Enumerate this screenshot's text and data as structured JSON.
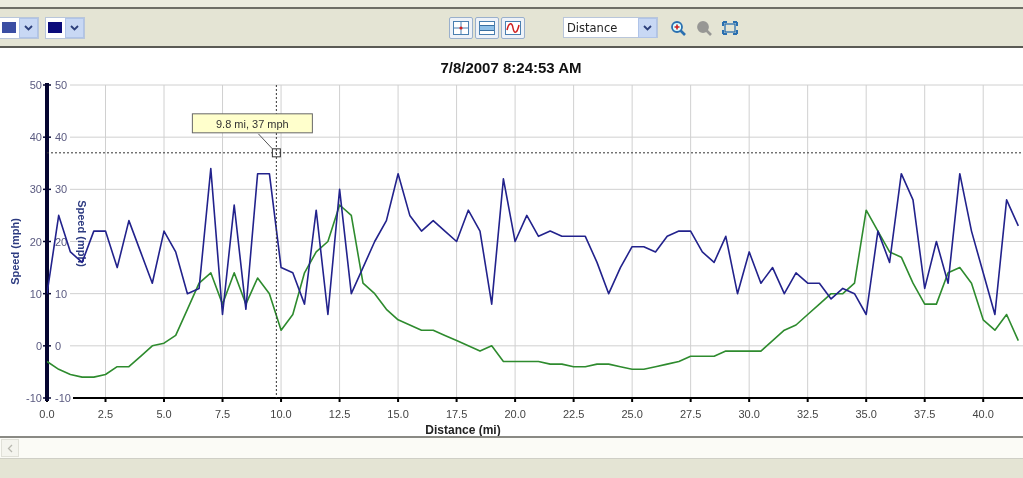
{
  "toolbar": {
    "color_pickers": [
      {
        "color": "#3b4ea3"
      },
      {
        "color": "#0b0b7a"
      }
    ],
    "view_buttons": [
      {
        "kind": "crosshair"
      },
      {
        "kind": "band"
      },
      {
        "kind": "wave"
      }
    ],
    "axis_select": {
      "value": "Distance"
    },
    "zoom_buttons": [
      {
        "kind": "zoom_in",
        "disabled": false
      },
      {
        "kind": "zoom_out",
        "disabled": true
      },
      {
        "kind": "fit",
        "disabled": false
      }
    ]
  },
  "chart": {
    "chart_data": {
      "type": "line",
      "title": "7/8/2007 8:24:53 AM",
      "xlabel": "Distance (mi)",
      "ylabel": "Speed (mph)",
      "y2label": "Speed (mph)",
      "x": [
        0,
        0.5,
        1,
        1.5,
        2,
        2.5,
        3,
        3.5,
        4,
        4.5,
        5,
        5.5,
        6,
        6.5,
        7,
        7.5,
        8,
        8.5,
        9,
        9.5,
        10,
        10.5,
        11,
        11.5,
        12,
        12.5,
        13,
        13.5,
        14,
        14.5,
        15,
        15.5,
        16,
        16.5,
        17,
        17.5,
        18,
        18.5,
        19,
        19.5,
        20,
        20.5,
        21,
        21.5,
        22,
        22.5,
        23,
        23.5,
        24,
        24.5,
        25,
        25.5,
        26,
        26.5,
        27,
        27.5,
        28,
        28.5,
        29,
        29.5,
        30,
        30.5,
        31,
        31.5,
        32,
        32.5,
        33,
        33.5,
        34,
        34.5,
        35,
        35.5,
        36,
        36.5,
        37,
        37.5,
        38,
        38.5,
        39,
        39.5,
        40,
        40.5,
        41,
        41.5
      ],
      "series": [
        {
          "color": "#22228c",
          "values": [
            10,
            25,
            18,
            16,
            22,
            22,
            15,
            24,
            18,
            12,
            22,
            18,
            10,
            11,
            34,
            6,
            27,
            7,
            33,
            33,
            15,
            14,
            8,
            26,
            6,
            30,
            10,
            15,
            20,
            24,
            33,
            25,
            22,
            24,
            22,
            20,
            26,
            22,
            8,
            32,
            20,
            25,
            21,
            22,
            21,
            21,
            21,
            16,
            10,
            15,
            19,
            19,
            18,
            21,
            22,
            22,
            18,
            16,
            21,
            10,
            18,
            12,
            15,
            10,
            14,
            12,
            12,
            9,
            11,
            10,
            6,
            22,
            16,
            33,
            28,
            11,
            20,
            12,
            33,
            22,
            14,
            6,
            28,
            23
          ]
        },
        {
          "color": "#2e8b2e",
          "values": [
            -3,
            -4.5,
            -5.5,
            -6,
            -6,
            -5.5,
            -4,
            -4,
            -2,
            0,
            0.5,
            2,
            7,
            12,
            14,
            8,
            14,
            8,
            13,
            10,
            3,
            6,
            14,
            18,
            20,
            27,
            25,
            12,
            10,
            7,
            5,
            4,
            3,
            3,
            2,
            1,
            0,
            -1,
            0,
            -3,
            -3,
            -3,
            -3,
            -3.5,
            -3.5,
            -4,
            -4,
            -3.5,
            -3.5,
            -4,
            -4.5,
            -4.5,
            -4,
            -3.5,
            -3,
            -2,
            -2,
            -2,
            -1,
            -1,
            -1,
            -1,
            1,
            3,
            4,
            6,
            8,
            10,
            10,
            12,
            26,
            22,
            18,
            17,
            12,
            8,
            8,
            14,
            15,
            12,
            5,
            3,
            6,
            1
          ]
        }
      ],
      "xlim": [
        0,
        41.7
      ],
      "ylim": [
        -10,
        50
      ],
      "xticks": [
        {
          "value": 0,
          "label": "0.0"
        },
        {
          "value": 2.5,
          "label": "2.5"
        },
        {
          "value": 5,
          "label": "5.0"
        },
        {
          "value": 7.5,
          "label": "7.5"
        },
        {
          "value": 10,
          "label": "10.0"
        },
        {
          "value": 12.5,
          "label": "12.5"
        },
        {
          "value": 15,
          "label": "15.0"
        },
        {
          "value": 17.5,
          "label": "17.5"
        },
        {
          "value": 20,
          "label": "20.0"
        },
        {
          "value": 22.5,
          "label": "22.5"
        },
        {
          "value": 25,
          "label": "25.0"
        },
        {
          "value": 27.5,
          "label": "27.5"
        },
        {
          "value": 30,
          "label": "30.0"
        },
        {
          "value": 32.5,
          "label": "32.5"
        },
        {
          "value": 35,
          "label": "35.0"
        },
        {
          "value": 37.5,
          "label": "37.5"
        },
        {
          "value": 40,
          "label": "40.0"
        }
      ],
      "yticks": [
        -10,
        0,
        10,
        20,
        30,
        40,
        50
      ],
      "y2ticks": [
        -10,
        0,
        10,
        20,
        30,
        40,
        50
      ],
      "y2lim": [
        -10,
        50
      ],
      "grid": true,
      "ref_lines": [
        {
          "axis": "x",
          "value": 9.8
        },
        {
          "axis": "y",
          "value": 37
        }
      ],
      "annotations": [
        {
          "x": 9.8,
          "y": 37,
          "text": "9.8 mi, 37 mph"
        }
      ]
    }
  }
}
